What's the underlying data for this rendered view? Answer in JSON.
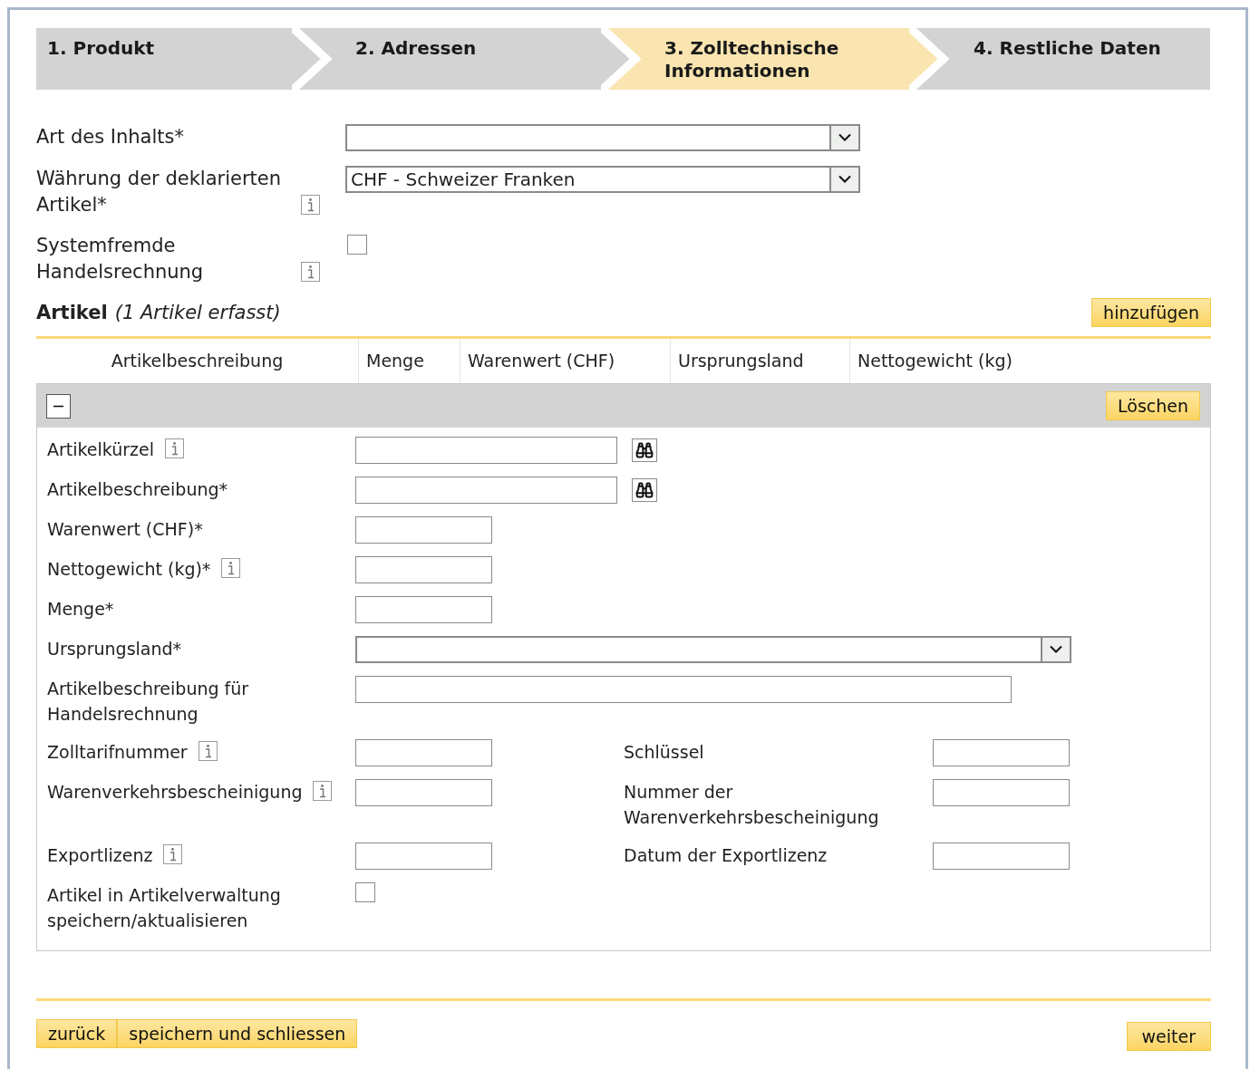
{
  "steps": [
    {
      "label": "1. Produkt",
      "selected": false
    },
    {
      "label": "2. Adressen",
      "selected": false
    },
    {
      "label": "3. Zolltechnische Informationen",
      "selected": true
    },
    {
      "label": "4. Restliche Daten",
      "selected": false
    }
  ],
  "form_fields": [
    {
      "label": "Art des Inhalts*",
      "info": false,
      "kind": "select"
    },
    {
      "label": "Währung der deklarierten Artikel*",
      "info": true,
      "kind": "select",
      "value": "CHF - Schweizer Franken"
    },
    {
      "label": "Systemfremde Handelsrechnung",
      "info": true,
      "kind": "checkbox",
      "checked": false
    }
  ],
  "articles": {
    "title": "Artikel",
    "count_text": "(1 Artikel erfasst)",
    "add_button": "hinzufügen"
  },
  "table": {
    "columns": [
      "Artikelbeschreibung",
      "Menge",
      "Warenwert (CHF)",
      "Ursprungsland",
      "Nettogewicht (kg)"
    ]
  },
  "article_panel": {
    "expanded": true,
    "delete_button": "Löschen",
    "fields": [
      {
        "label": "Artikelkürzel",
        "info": true,
        "kind": "search"
      },
      {
        "label": "Artikelbeschreibung*",
        "info": false,
        "kind": "search"
      },
      {
        "label": "Warenwert (CHF)*",
        "info": false,
        "kind": "short"
      },
      {
        "label": "Nettogewicht (kg)*",
        "info": true,
        "kind": "short"
      },
      {
        "label": "Menge*",
        "info": false,
        "kind": "short"
      },
      {
        "label": "Ursprungsland*",
        "info": false,
        "kind": "select"
      },
      {
        "label": "Artikelbeschreibung für Handelsrechnung",
        "info": false,
        "kind": "wide"
      },
      {
        "label": "Zolltarifnummer",
        "info": true,
        "kind": "short",
        "right_label": "Schlüssel"
      },
      {
        "label": "Warenverkehrsbescheinigung",
        "info": true,
        "kind": "short",
        "right_label": "Nummer der Warenverkehrsbescheinigung"
      },
      {
        "label": "Exportlizenz",
        "info": true,
        "kind": "short",
        "right_label": "Datum der Exportlizenz"
      },
      {
        "label": "Artikel in Artikelverwaltung speichern/aktualisieren",
        "info": false,
        "kind": "checkbox",
        "checked": false
      }
    ]
  },
  "footer": {
    "back_button": "zurück",
    "save_button": "speichern und schliessen",
    "next_button": "weiter"
  }
}
